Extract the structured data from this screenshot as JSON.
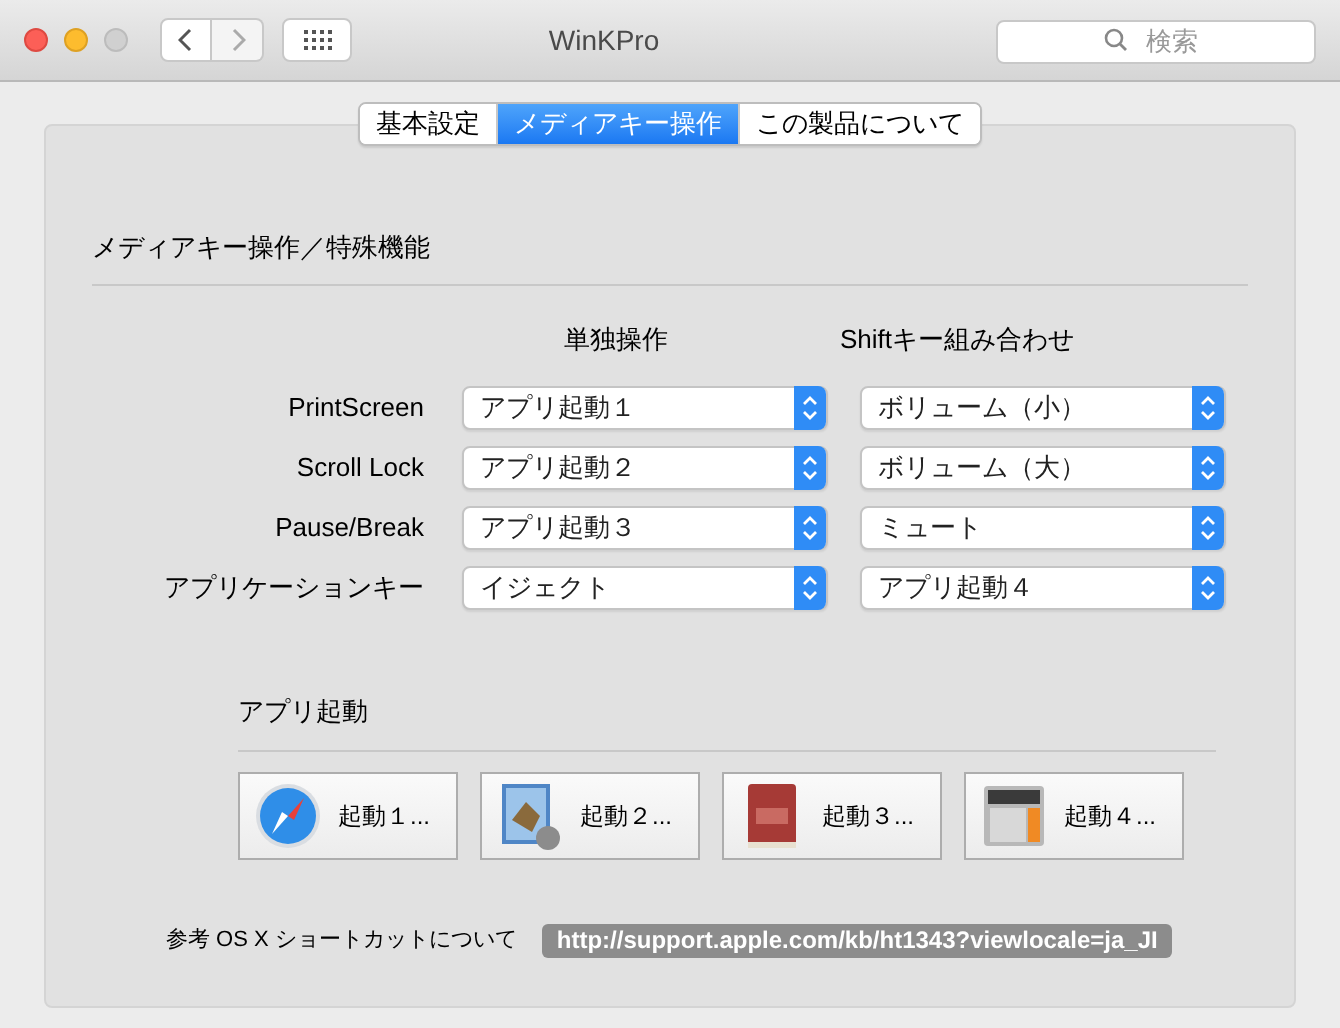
{
  "window": {
    "title": "WinKPro"
  },
  "search": {
    "placeholder": "検索"
  },
  "tabs": [
    {
      "label": "基本設定",
      "selected": false
    },
    {
      "label": "メディアキー操作",
      "selected": true
    },
    {
      "label": "この製品について",
      "selected": false
    }
  ],
  "section": {
    "title": "メディアキー操作／特殊機能"
  },
  "columns": [
    "単独操作",
    "Shiftキー組み合わせ"
  ],
  "rows": [
    {
      "label": "PrintScreen",
      "single": "アプリ起動１",
      "shift": "ボリューム（小）"
    },
    {
      "label": "Scroll Lock",
      "single": "アプリ起動２",
      "shift": "ボリューム（大）"
    },
    {
      "label": "Pause/Break",
      "single": "アプリ起動３",
      "shift": "ミュート"
    },
    {
      "label": "アプリケーションキー",
      "single": "イジェクト",
      "shift": "アプリ起動４"
    }
  ],
  "launcher": {
    "title": "アプリ起動",
    "buttons": [
      {
        "kind": "compass",
        "label": "起動１..."
      },
      {
        "kind": "photo",
        "label": "起動２..."
      },
      {
        "kind": "book",
        "label": "起動３..."
      },
      {
        "kind": "calculator",
        "label": "起動４..."
      }
    ]
  },
  "footer": {
    "label": "参考 OS X ショートカットについて",
    "link": "http://support.apple.com/kb/ht1343?viewlocale=ja_JI"
  }
}
